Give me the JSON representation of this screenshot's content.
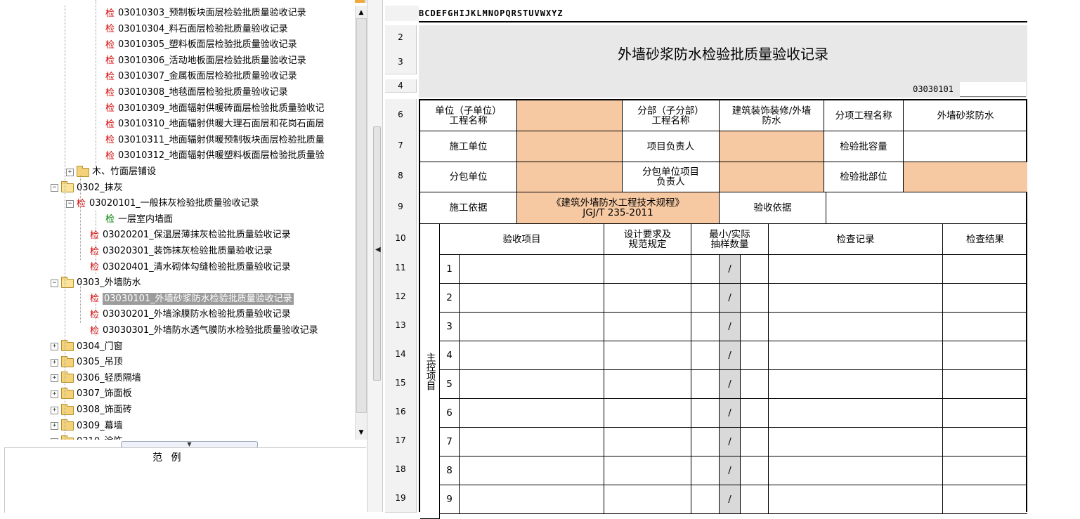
{
  "tree": {
    "items": [
      {
        "label": "03010303_预制板块面层检验批质量验收记录",
        "icon": "jian"
      },
      {
        "label": "03010304_料石面层检验批质量验收记录",
        "icon": "jian"
      },
      {
        "label": "03010305_塑料板面层检验批质量验收记录",
        "icon": "jian"
      },
      {
        "label": "03010306_活动地板面层检验批质量验收记录",
        "icon": "jian"
      },
      {
        "label": "03010307_金属板面层检验批质量验收记录",
        "icon": "jian"
      },
      {
        "label": "03010308_地毯面层检验批质量验收记录",
        "icon": "jian"
      },
      {
        "label": "03010309_地面辐射供暖砖面层检验批质量验收记",
        "icon": "jian"
      },
      {
        "label": "03010310_地面辐射供暖大理石面层和花岗石面层",
        "icon": "jian"
      },
      {
        "label": "03010311_地面辐射供暖预制板块面层检验批质量",
        "icon": "jian"
      },
      {
        "label": "03010312_地面辐射供暖塑料板面层检验批质量验",
        "icon": "jian"
      },
      {
        "label": "木、竹面层铺设",
        "icon": "folder"
      },
      {
        "label": "0302_抹灰",
        "icon": "folder-open"
      },
      {
        "label": "03020101_一般抹灰检验批质量验收记录",
        "icon": "jian"
      },
      {
        "label": "一层室内墙面",
        "icon": "jian-green"
      },
      {
        "label": "03020201_保温层薄抹灰检验批质量验收记录",
        "icon": "jian"
      },
      {
        "label": "03020301_装饰抹灰检验批质量验收记录",
        "icon": "jian"
      },
      {
        "label": "03020401_清水砌体勾缝检验批质量验收记录",
        "icon": "jian"
      },
      {
        "label": "0303_外墙防水",
        "icon": "folder-open"
      },
      {
        "label": "03030101_外墙砂浆防水检验批质量验收记录",
        "icon": "jian",
        "selected": true
      },
      {
        "label": "03030201_外墙涂膜防水检验批质量验收记录",
        "icon": "jian"
      },
      {
        "label": "03030301_外墙防水透气膜防水检验批质量验收记录",
        "icon": "jian"
      },
      {
        "label": "0304_门窗",
        "icon": "folder"
      },
      {
        "label": "0305_吊顶",
        "icon": "folder"
      },
      {
        "label": "0306_轻质隔墙",
        "icon": "folder"
      },
      {
        "label": "0307_饰面板",
        "icon": "folder"
      },
      {
        "label": "0308_饰面砖",
        "icon": "folder"
      },
      {
        "label": "0309_幕墙",
        "icon": "folder"
      },
      {
        "label": "0310_涂饰",
        "icon": "folder"
      }
    ],
    "jian_char": "检",
    "expand_plus": "+",
    "expand_minus": "−"
  },
  "legend": {
    "title": "范 例"
  },
  "sheet": {
    "column_letters": "BCDEFGHIJKLMNOPQRSTUVWXYZ",
    "title": "外墙砂浆防水检验批质量验收记录",
    "code": "03030101",
    "row_numbers": [
      "2",
      "3",
      "4",
      "6",
      "7",
      "8",
      "9",
      "10",
      "11",
      "12",
      "13",
      "14",
      "15",
      "16",
      "17",
      "18",
      "19"
    ],
    "form": {
      "unit_label": "单位（子单位）\n工程名称",
      "division_label": "分部（子分部）\n工程名称",
      "division_value": "建筑装饰装修/外墙\n防水",
      "subitem_label": "分项工程名称",
      "subitem_value": "外墙砂浆防水",
      "contractor_label": "施工单位",
      "pm_label": "项目负责人",
      "capacity_label": "检验批容量",
      "subcontractor_label": "分包单位",
      "sub_pm_label": "分包单位项目\n负责人",
      "location_label": "检验批部位",
      "basis_label": "施工依据",
      "basis_value": "《建筑外墙防水工程技术规程》\nJGJ/T 235-2011",
      "accept_basis_label": "验收依据",
      "col_item": "验收项目",
      "col_design": "设计要求及\n规范规定",
      "col_sample": "最小/实际\n抽样数量",
      "col_record": "检查记录",
      "col_result": "检查结果",
      "main_control": "主控项目",
      "slash": "/",
      "item_numbers": [
        "1",
        "2",
        "3",
        "4",
        "5",
        "6",
        "7",
        "8",
        "9"
      ]
    }
  }
}
